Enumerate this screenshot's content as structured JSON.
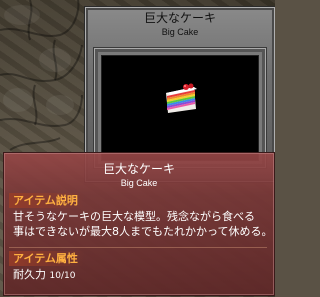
{
  "item_window": {
    "title": "巨大なケーキ",
    "subtitle": "Big Cake",
    "icon": "cake-slice-icon"
  },
  "info_window": {
    "title": "巨大なケーキ",
    "subtitle": "Big Cake",
    "description_label": "アイテム説明",
    "description_lines": [
      "甘そうなケーキの巨大な模型。残念ながら食べる",
      "事はできないが最大8人までもたれかかって休める。"
    ],
    "attribute_label": "アイテム属性",
    "attributes": [
      {
        "name": "耐久力",
        "value": "10/10"
      }
    ]
  },
  "colors": {
    "label_accent": "#ffb040",
    "info_background": "#7a3636",
    "preview_background": "#000000"
  }
}
